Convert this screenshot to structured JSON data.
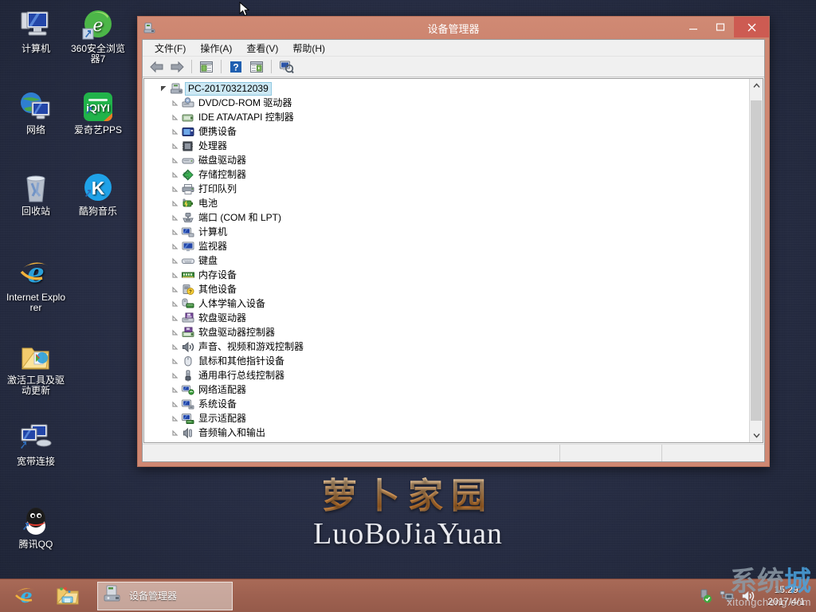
{
  "desktop": {
    "wallpaper_color": "#2b3148",
    "logo": {
      "cn": "萝卜家园",
      "en": "LuoBoJiaYuan"
    },
    "icons": [
      {
        "label": "计算机",
        "icon": "computer-icon"
      },
      {
        "label": "360安全浏览器7",
        "icon": "360-browser-icon"
      },
      {
        "label": "网络",
        "icon": "network-icon"
      },
      {
        "label": "爱奇艺PPS",
        "icon": "iqiyi-pps-icon"
      },
      {
        "label": "回收站",
        "icon": "recycle-bin-icon"
      },
      {
        "label": "酷狗音乐",
        "icon": "kugou-music-icon"
      },
      {
        "label": "Internet Explorer",
        "icon": "internet-explorer-icon"
      },
      {
        "label": "激活工具及驱动更新",
        "icon": "folder-icon"
      },
      {
        "label": "宽带连接",
        "icon": "broadband-connection-icon"
      },
      {
        "label": "腾讯QQ",
        "icon": "tencent-qq-icon"
      }
    ]
  },
  "window": {
    "title": "设备管理器",
    "title_icon": "device-manager-icon",
    "accent_color": "#cd8570",
    "close_color": "#cd5b52",
    "buttons": {
      "minimize": "—",
      "maximize": "❐",
      "close": "✕"
    },
    "menu": [
      {
        "label": "文件(F)",
        "name": "menu-file"
      },
      {
        "label": "操作(A)",
        "name": "menu-action"
      },
      {
        "label": "查看(V)",
        "name": "menu-view"
      },
      {
        "label": "帮助(H)",
        "name": "menu-help"
      }
    ],
    "toolbar": [
      {
        "name": "back-arrow-icon",
        "title": "后退"
      },
      {
        "name": "forward-arrow-icon",
        "title": "前进"
      },
      {
        "name": "separator",
        "title": ""
      },
      {
        "name": "properties-icon",
        "title": "属性"
      },
      {
        "name": "separator",
        "title": ""
      },
      {
        "name": "help-icon",
        "title": "帮助"
      },
      {
        "name": "show-hide-console-tree-icon",
        "title": "显示/隐藏控制台树"
      },
      {
        "name": "separator",
        "title": ""
      },
      {
        "name": "scan-hardware-changes-icon",
        "title": "扫描检测硬件改动"
      }
    ],
    "tree": {
      "root": {
        "label": "PC-201703212039",
        "icon": "computer-node-icon",
        "selected": true
      },
      "nodes": [
        {
          "label": "DVD/CD-ROM 驱动器",
          "icon": "dvd-drive-icon"
        },
        {
          "label": "IDE ATA/ATAPI 控制器",
          "icon": "ide-controller-icon"
        },
        {
          "label": "便携设备",
          "icon": "portable-device-icon"
        },
        {
          "label": "处理器",
          "icon": "processor-icon"
        },
        {
          "label": "磁盘驱动器",
          "icon": "disk-drive-icon"
        },
        {
          "label": "存储控制器",
          "icon": "storage-controller-icon"
        },
        {
          "label": "打印队列",
          "icon": "print-queue-icon"
        },
        {
          "label": "电池",
          "icon": "battery-icon"
        },
        {
          "label": "端口 (COM 和 LPT)",
          "icon": "ports-icon"
        },
        {
          "label": "计算机",
          "icon": "computer-icon"
        },
        {
          "label": "监视器",
          "icon": "monitor-icon"
        },
        {
          "label": "键盘",
          "icon": "keyboard-icon"
        },
        {
          "label": "内存设备",
          "icon": "memory-device-icon"
        },
        {
          "label": "其他设备",
          "icon": "other-devices-icon"
        },
        {
          "label": "人体学输入设备",
          "icon": "hid-icon"
        },
        {
          "label": "软盘驱动器",
          "icon": "floppy-drive-icon"
        },
        {
          "label": "软盘驱动器控制器",
          "icon": "floppy-controller-icon"
        },
        {
          "label": "声音、视频和游戏控制器",
          "icon": "sound-video-game-icon"
        },
        {
          "label": "鼠标和其他指针设备",
          "icon": "mouse-icon"
        },
        {
          "label": "通用串行总线控制器",
          "icon": "usb-controller-icon"
        },
        {
          "label": "网络适配器",
          "icon": "network-adapter-icon"
        },
        {
          "label": "系统设备",
          "icon": "system-device-icon"
        },
        {
          "label": "显示适配器",
          "icon": "display-adapter-icon"
        },
        {
          "label": "音频输入和输出",
          "icon": "audio-io-icon"
        }
      ]
    },
    "scrollbar": {
      "up": "⌃",
      "down": "⌄"
    },
    "statusbar": {
      "main": "",
      "pane2": "",
      "pane3": ""
    }
  },
  "taskbar": {
    "quick_launch": [
      {
        "name": "internet-explorer-icon",
        "label": "Internet Explorer"
      },
      {
        "name": "file-explorer-icon",
        "label": "文件资源管理器"
      }
    ],
    "task_button": {
      "label": "设备管理器",
      "icon": "device-manager-icon",
      "active": true
    },
    "tray": [
      {
        "name": "safely-remove-hardware-icon",
        "label": "安全删除硬件"
      },
      {
        "name": "network-tray-icon",
        "label": "网络"
      },
      {
        "name": "volume-tray-icon",
        "label": "音量"
      }
    ],
    "clock": {
      "time": "15:29",
      "date": "2017/4/1"
    }
  },
  "watermark": {
    "cn_left": "系统",
    "cn_right": "城",
    "en": "xitongcheng.com"
  }
}
